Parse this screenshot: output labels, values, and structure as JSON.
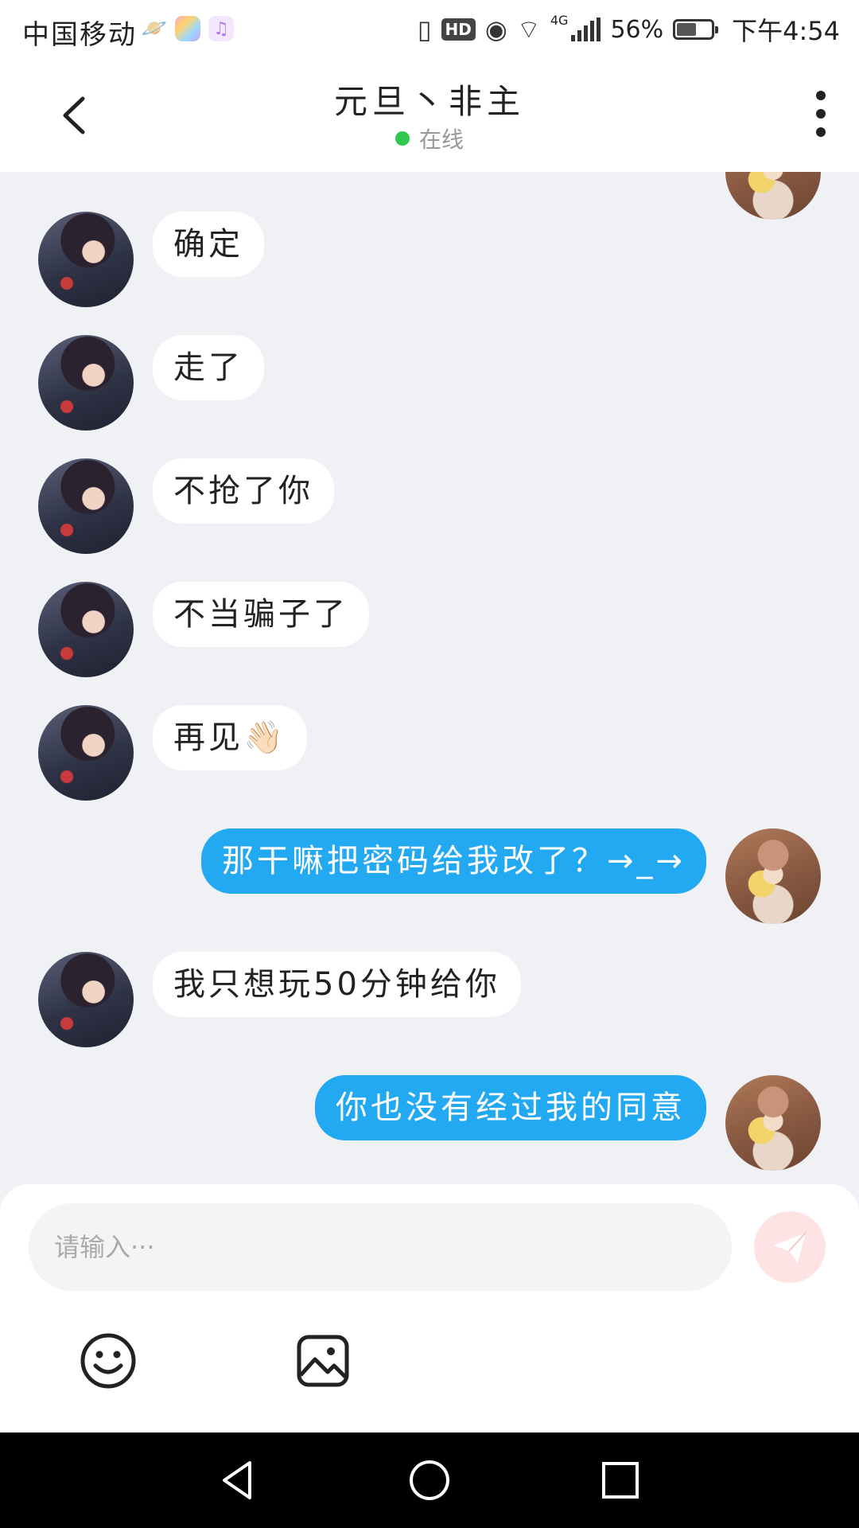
{
  "status_bar": {
    "carrier": "中国移动",
    "network": "4G",
    "hd": "HD",
    "battery_percent": "56%",
    "battery_level": 0.56,
    "time": "下午4:54",
    "app_icons": [
      "planet-icon",
      "photos-icon",
      "music-icon"
    ]
  },
  "header": {
    "title": "元旦丶非主",
    "status": "在线",
    "status_color": "#2dc84d"
  },
  "messages": [
    {
      "side": "in",
      "text": "确定"
    },
    {
      "side": "in",
      "text": "走了"
    },
    {
      "side": "in",
      "text": "不抢了你"
    },
    {
      "side": "in",
      "text": "不当骗子了"
    },
    {
      "side": "in",
      "text": "再见👋🏻"
    },
    {
      "side": "out",
      "text": "那干嘛把密码给我改了？→_→"
    },
    {
      "side": "in",
      "text": "我只想玩50分钟给你"
    },
    {
      "side": "out",
      "text": "你也没有经过我的同意"
    }
  ],
  "composer": {
    "placeholder": "请输入···"
  },
  "colors": {
    "outgoing_bubble": "#23a8f2",
    "incoming_bubble": "#ffffff",
    "chat_background": "#f0f1f5",
    "send_button": "#fde3e3"
  }
}
